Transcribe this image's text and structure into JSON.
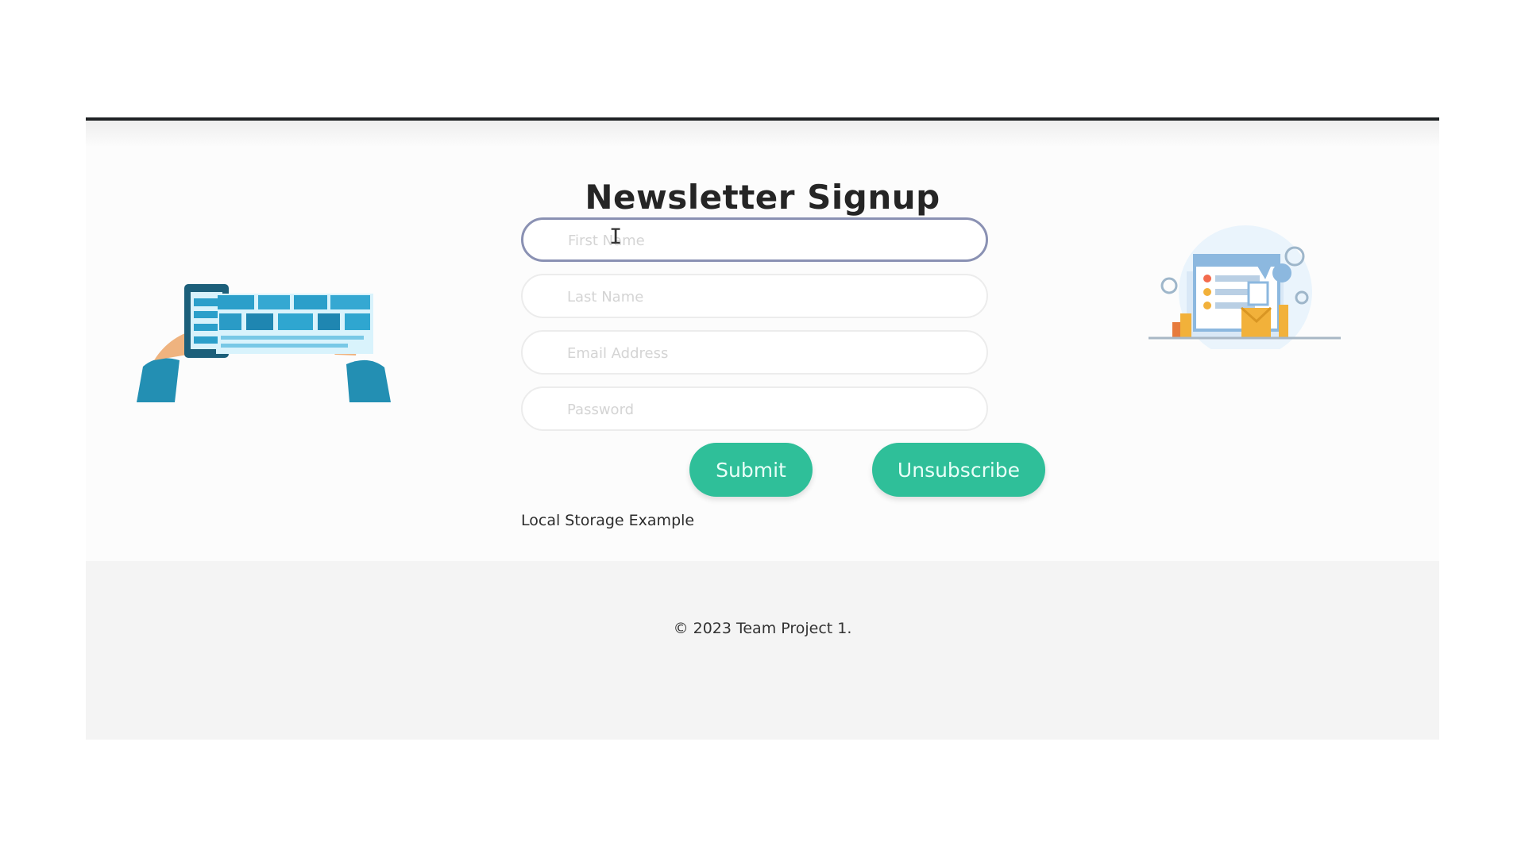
{
  "page": {
    "title": "Newsletter Signup"
  },
  "form": {
    "first_name_placeholder": "First Name",
    "last_name_placeholder": "Last Name",
    "email_placeholder": "Email Address",
    "password_placeholder": "Password"
  },
  "buttons": {
    "submit_label": "Submit",
    "unsubscribe_label": "Unsubscribe"
  },
  "links": {
    "local_storage_label": "Local Storage Example"
  },
  "footer": {
    "copyright": "© 2023 Team Project 1."
  },
  "icons": {
    "left_illustration": "newspaper-illustration-icon",
    "right_illustration": "newsletter-email-illustration-icon",
    "text_cursor": "text-cursor-icon"
  },
  "colors": {
    "accent": "#2fbf99",
    "focus_border": "#8a91b3",
    "illustration_blue": "#238fb3",
    "illustration_orange": "#f2b13a"
  }
}
